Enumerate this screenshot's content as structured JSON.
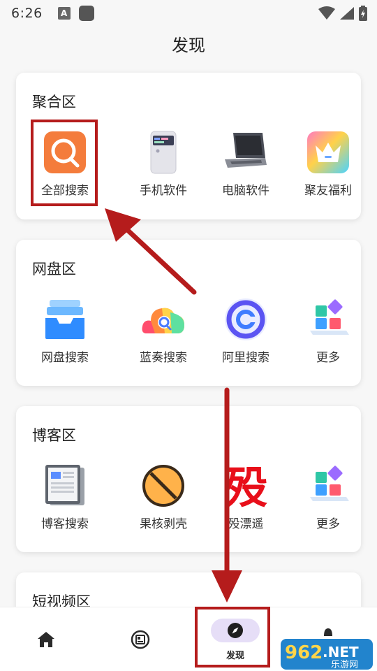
{
  "status_bar": {
    "time": "6:26",
    "a_badge": "A"
  },
  "page": {
    "title": "发现"
  },
  "sections": [
    {
      "title": "聚合区",
      "items": [
        {
          "label": "全部搜索",
          "icon": "orange-search-icon"
        },
        {
          "label": "手机软件",
          "icon": "phone-icon"
        },
        {
          "label": "电脑软件",
          "icon": "laptop-icon"
        },
        {
          "label": "聚友福利",
          "icon": "crown-icon"
        }
      ]
    },
    {
      "title": "网盘区",
      "items": [
        {
          "label": "网盘搜索",
          "icon": "drive-tray-icon"
        },
        {
          "label": "蓝奏搜索",
          "icon": "rainbow-cloud-icon"
        },
        {
          "label": "阿里搜索",
          "icon": "aliyun-icon"
        },
        {
          "label": "更多",
          "icon": "blocks-icon"
        }
      ]
    },
    {
      "title": "博客区",
      "items": [
        {
          "label": "博客搜索",
          "icon": "newspaper-icon"
        },
        {
          "label": "果核剥壳",
          "icon": "nut-icon"
        },
        {
          "label": "殁漂遥",
          "icon": "mo-glyph-icon",
          "glyph": "殁"
        },
        {
          "label": "更多",
          "icon": "blocks-icon"
        }
      ]
    },
    {
      "title": "短视频区"
    }
  ],
  "tabbar": {
    "tabs": [
      {
        "icon": "home-icon"
      },
      {
        "icon": "news-icon"
      },
      {
        "icon": "compass-icon",
        "label": "发现",
        "active": true
      },
      {
        "icon": "profile-icon"
      }
    ]
  },
  "watermark": {
    "number": "962",
    "suffix": ".NET",
    "site": "乐游网"
  },
  "colors": {
    "highlight": "#b51c1c",
    "active_tab_pill": "#e6def7",
    "search_orange": "#f47c3c"
  }
}
